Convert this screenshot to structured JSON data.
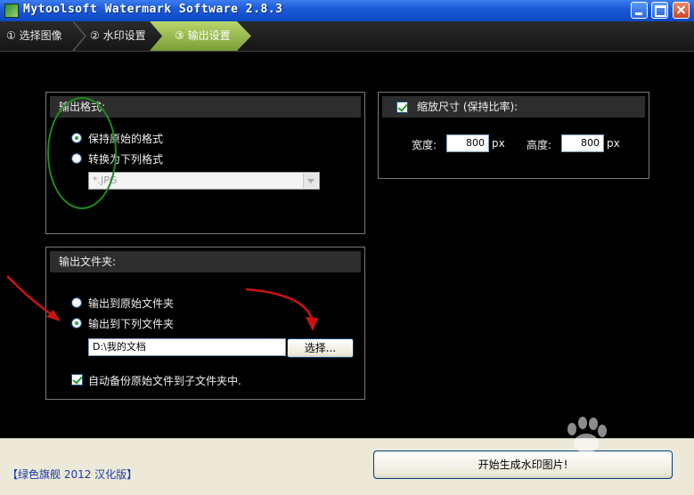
{
  "window": {
    "title": "Mytoolsoft Watermark Software 2.8.3"
  },
  "steps": [
    {
      "label": "① 选择图像"
    },
    {
      "label": "② 水印设置"
    },
    {
      "label": "③ 输出设置"
    }
  ],
  "output_format": {
    "header": "输出格式:",
    "keep_original": "保持原始的格式",
    "convert_to": "转换为下列格式",
    "selected_format": "*.JPG"
  },
  "resize": {
    "header": "缩放尺寸 (保持比率):",
    "width_label": "宽度:",
    "width_value": "800",
    "width_unit": "px",
    "height_label": "高度:",
    "height_value": "800",
    "height_unit": "px"
  },
  "output_folder": {
    "header": "输出文件夹:",
    "to_original": "输出到原始文件夹",
    "to_following": "输出到下列文件夹",
    "path": "D:\\我的文档",
    "choose_button": "选择...",
    "backup_label": "自动备份原始文件到子文件夹中."
  },
  "footer": {
    "brand": "【绿色旗舰 2012 汉化版】",
    "start_button": "开始生成水印图片!"
  },
  "colors": {
    "active_step": "#9cc24e",
    "annotation_red": "#cc1111",
    "annotation_green": "#1e8a1e"
  }
}
